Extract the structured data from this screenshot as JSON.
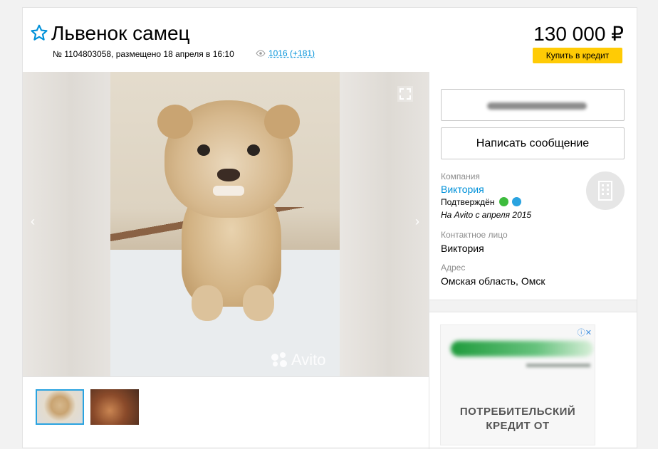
{
  "listing": {
    "title": "Львенок самец",
    "meta": "№ 1104803058, размещено 18 апреля в 16:10",
    "views": "1016 (+181)",
    "price": "130 000 ₽",
    "credit_label": "Купить в кредит"
  },
  "gallery": {
    "watermark": "Avito",
    "prev_arrow": "‹",
    "next_arrow": "›",
    "thumbnail_count": 2
  },
  "seller": {
    "write_message": "Написать сообщение",
    "company_label": "Компания",
    "company_name": "Виктория",
    "verified_label": "Подтверждён",
    "since": "На Avito с апреля 2015",
    "contact_label": "Контактное лицо",
    "contact_name": "Виктория",
    "address_label": "Адрес",
    "address": "Омская область, Омск"
  },
  "ad": {
    "badge": "ⓘ✕",
    "text_line1": "ПОТРЕБИТЕЛЬСКИЙ",
    "text_line2": "КРЕДИТ ОТ"
  },
  "colors": {
    "link": "#0091d9",
    "credit_button": "#ffcb05",
    "star": "#0091d9",
    "phone_badge": "#3dbb3d",
    "mail_badge": "#2aa3e0"
  }
}
